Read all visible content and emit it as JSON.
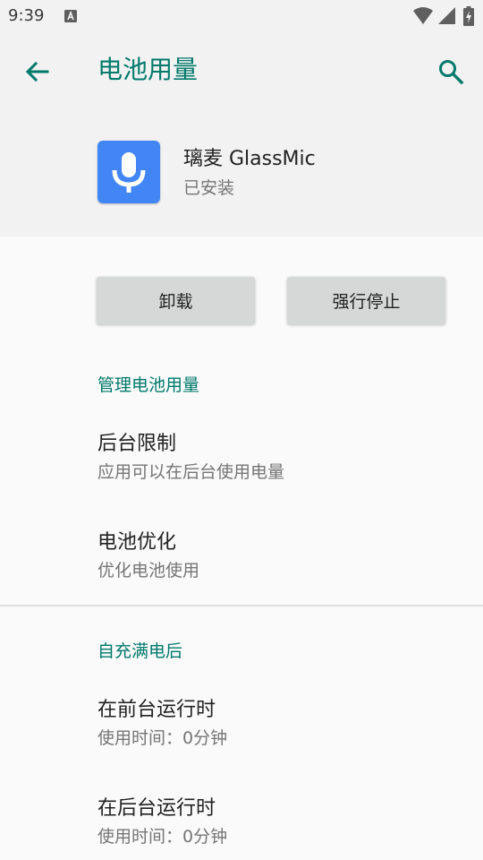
{
  "status_bar": {
    "time": "9:39",
    "notification_icon": "a-box-icon",
    "icons": [
      "wifi-icon",
      "signal-icon",
      "battery-charging-icon"
    ]
  },
  "app_bar": {
    "title": "电池用量",
    "back_icon": "arrow-back-icon",
    "search_icon": "search-icon",
    "accent_color": "#00796b"
  },
  "app_header": {
    "name": "璃麦 GlassMic",
    "status": "已安装",
    "icon": "microphone-icon",
    "icon_color": "#4285f4"
  },
  "actions": {
    "uninstall_label": "卸载",
    "force_stop_label": "强行停止"
  },
  "manage_section": {
    "header": "管理电池用量",
    "items": [
      {
        "title": "后台限制",
        "summary": "应用可以在后台使用电量"
      },
      {
        "title": "电池优化",
        "summary": "优化电池使用"
      }
    ]
  },
  "since_charge_section": {
    "header": "自充满电后",
    "items": [
      {
        "title": "在前台运行时",
        "summary": "使用时间：0分钟"
      },
      {
        "title": "在后台运行时",
        "summary": "使用时间：0分钟"
      }
    ]
  }
}
